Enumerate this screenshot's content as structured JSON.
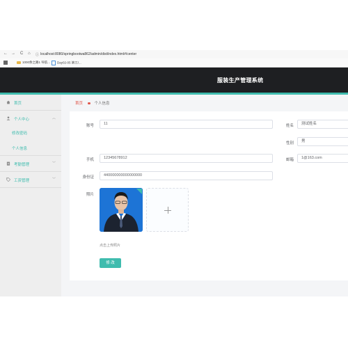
{
  "browser": {
    "back": "←",
    "forward": "→",
    "reload": "C",
    "home": "⌂",
    "info": "ⓘ",
    "url": "localhost:8080/springbootwa862/admin/dist/index.html#/center"
  },
  "bookmarks": [
    {
      "label": "1000余之路1 导航..."
    },
    {
      "label": "Day02-05 第三/..."
    }
  ],
  "app": {
    "title": "服装生产管理系统"
  },
  "sidebar": {
    "items": [
      {
        "label": "首页"
      },
      {
        "label": "个人中心",
        "chevron": "︿"
      },
      {
        "label": "修改密码"
      },
      {
        "label": "个人信息"
      },
      {
        "label": "考勤管理",
        "chevron": "﹀"
      },
      {
        "label": "工资管理",
        "chevron": "﹀"
      }
    ]
  },
  "breadcrumb": {
    "home": "首页",
    "current": "个人信息"
  },
  "form": {
    "account_label": "账号",
    "account_value": "11",
    "name_label": "姓名",
    "name_value": "测试姓名",
    "gender_label": "性别",
    "gender_value": "男",
    "phone_label": "手机",
    "phone_value": "12345678912",
    "email_label": "邮箱",
    "email_value": "1@163.com",
    "idcard_label": "身份证",
    "idcard_value": "440000000000000000",
    "photo_label": "照片",
    "upload_hint": "点击上传照片",
    "submit_label": "修 改"
  },
  "colors": {
    "accent": "#3fbcae",
    "header": "#1e1f22",
    "breadcrumb_home": "#e0564a"
  }
}
